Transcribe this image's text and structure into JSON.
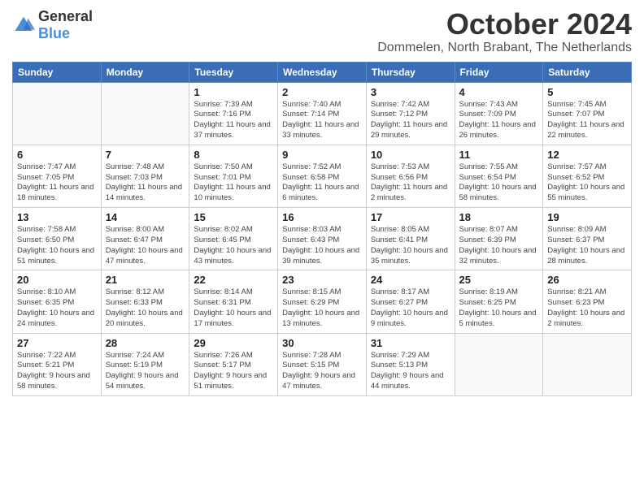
{
  "header": {
    "logo": {
      "general": "General",
      "blue": "Blue"
    },
    "month": "October 2024",
    "location": "Dommelen, North Brabant, The Netherlands"
  },
  "days_header": [
    "Sunday",
    "Monday",
    "Tuesday",
    "Wednesday",
    "Thursday",
    "Friday",
    "Saturday"
  ],
  "weeks": [
    [
      {
        "day": "",
        "info": ""
      },
      {
        "day": "",
        "info": ""
      },
      {
        "day": "1",
        "info": "Sunrise: 7:39 AM\nSunset: 7:16 PM\nDaylight: 11 hours and 37 minutes."
      },
      {
        "day": "2",
        "info": "Sunrise: 7:40 AM\nSunset: 7:14 PM\nDaylight: 11 hours and 33 minutes."
      },
      {
        "day": "3",
        "info": "Sunrise: 7:42 AM\nSunset: 7:12 PM\nDaylight: 11 hours and 29 minutes."
      },
      {
        "day": "4",
        "info": "Sunrise: 7:43 AM\nSunset: 7:09 PM\nDaylight: 11 hours and 26 minutes."
      },
      {
        "day": "5",
        "info": "Sunrise: 7:45 AM\nSunset: 7:07 PM\nDaylight: 11 hours and 22 minutes."
      }
    ],
    [
      {
        "day": "6",
        "info": "Sunrise: 7:47 AM\nSunset: 7:05 PM\nDaylight: 11 hours and 18 minutes."
      },
      {
        "day": "7",
        "info": "Sunrise: 7:48 AM\nSunset: 7:03 PM\nDaylight: 11 hours and 14 minutes."
      },
      {
        "day": "8",
        "info": "Sunrise: 7:50 AM\nSunset: 7:01 PM\nDaylight: 11 hours and 10 minutes."
      },
      {
        "day": "9",
        "info": "Sunrise: 7:52 AM\nSunset: 6:58 PM\nDaylight: 11 hours and 6 minutes."
      },
      {
        "day": "10",
        "info": "Sunrise: 7:53 AM\nSunset: 6:56 PM\nDaylight: 11 hours and 2 minutes."
      },
      {
        "day": "11",
        "info": "Sunrise: 7:55 AM\nSunset: 6:54 PM\nDaylight: 10 hours and 58 minutes."
      },
      {
        "day": "12",
        "info": "Sunrise: 7:57 AM\nSunset: 6:52 PM\nDaylight: 10 hours and 55 minutes."
      }
    ],
    [
      {
        "day": "13",
        "info": "Sunrise: 7:58 AM\nSunset: 6:50 PM\nDaylight: 10 hours and 51 minutes."
      },
      {
        "day": "14",
        "info": "Sunrise: 8:00 AM\nSunset: 6:47 PM\nDaylight: 10 hours and 47 minutes."
      },
      {
        "day": "15",
        "info": "Sunrise: 8:02 AM\nSunset: 6:45 PM\nDaylight: 10 hours and 43 minutes."
      },
      {
        "day": "16",
        "info": "Sunrise: 8:03 AM\nSunset: 6:43 PM\nDaylight: 10 hours and 39 minutes."
      },
      {
        "day": "17",
        "info": "Sunrise: 8:05 AM\nSunset: 6:41 PM\nDaylight: 10 hours and 35 minutes."
      },
      {
        "day": "18",
        "info": "Sunrise: 8:07 AM\nSunset: 6:39 PM\nDaylight: 10 hours and 32 minutes."
      },
      {
        "day": "19",
        "info": "Sunrise: 8:09 AM\nSunset: 6:37 PM\nDaylight: 10 hours and 28 minutes."
      }
    ],
    [
      {
        "day": "20",
        "info": "Sunrise: 8:10 AM\nSunset: 6:35 PM\nDaylight: 10 hours and 24 minutes."
      },
      {
        "day": "21",
        "info": "Sunrise: 8:12 AM\nSunset: 6:33 PM\nDaylight: 10 hours and 20 minutes."
      },
      {
        "day": "22",
        "info": "Sunrise: 8:14 AM\nSunset: 6:31 PM\nDaylight: 10 hours and 17 minutes."
      },
      {
        "day": "23",
        "info": "Sunrise: 8:15 AM\nSunset: 6:29 PM\nDaylight: 10 hours and 13 minutes."
      },
      {
        "day": "24",
        "info": "Sunrise: 8:17 AM\nSunset: 6:27 PM\nDaylight: 10 hours and 9 minutes."
      },
      {
        "day": "25",
        "info": "Sunrise: 8:19 AM\nSunset: 6:25 PM\nDaylight: 10 hours and 5 minutes."
      },
      {
        "day": "26",
        "info": "Sunrise: 8:21 AM\nSunset: 6:23 PM\nDaylight: 10 hours and 2 minutes."
      }
    ],
    [
      {
        "day": "27",
        "info": "Sunrise: 7:22 AM\nSunset: 5:21 PM\nDaylight: 9 hours and 58 minutes."
      },
      {
        "day": "28",
        "info": "Sunrise: 7:24 AM\nSunset: 5:19 PM\nDaylight: 9 hours and 54 minutes."
      },
      {
        "day": "29",
        "info": "Sunrise: 7:26 AM\nSunset: 5:17 PM\nDaylight: 9 hours and 51 minutes."
      },
      {
        "day": "30",
        "info": "Sunrise: 7:28 AM\nSunset: 5:15 PM\nDaylight: 9 hours and 47 minutes."
      },
      {
        "day": "31",
        "info": "Sunrise: 7:29 AM\nSunset: 5:13 PM\nDaylight: 9 hours and 44 minutes."
      },
      {
        "day": "",
        "info": ""
      },
      {
        "day": "",
        "info": ""
      }
    ]
  ]
}
